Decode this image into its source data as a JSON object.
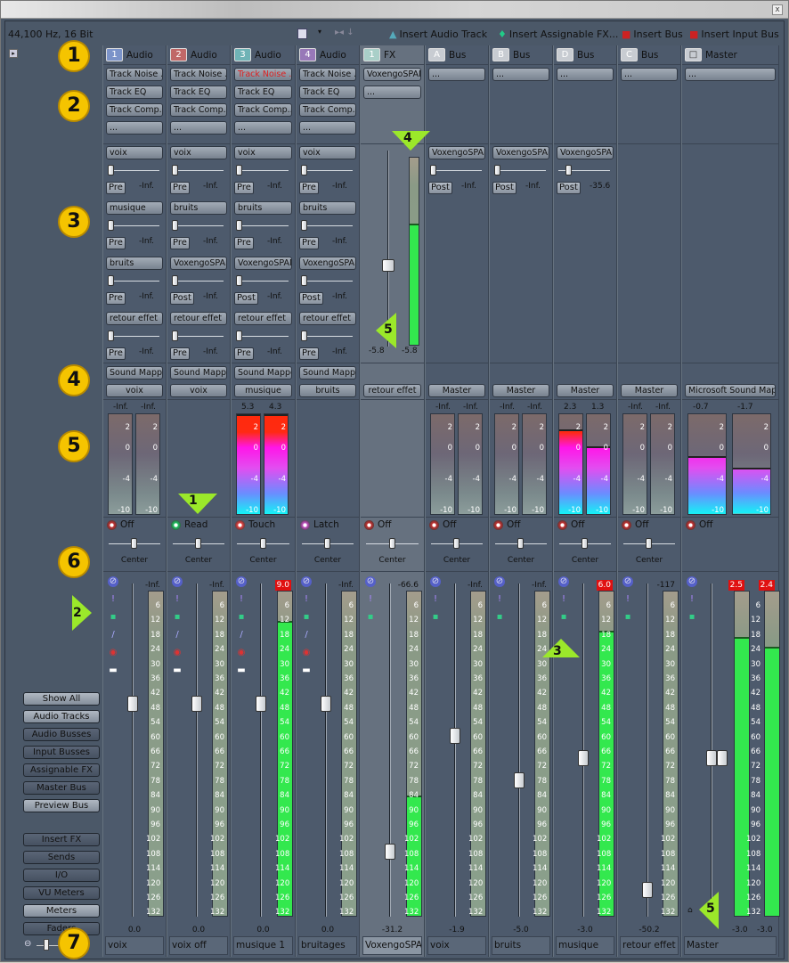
{
  "window": {
    "close_label": "x"
  },
  "toolbar": {
    "format": "44,100 Hz, 16 Bit",
    "insert_audio_track": "Insert Audio Track",
    "insert_assignable_fx": "Insert Assignable FX...",
    "insert_bus": "Insert Bus",
    "insert_input_bus": "Insert Input Bus"
  },
  "sidebar": {
    "view_buttons": [
      {
        "label": "Show All",
        "on": true
      },
      {
        "label": "Audio Tracks",
        "on": true
      },
      {
        "label": "Audio Busses",
        "on": false
      },
      {
        "label": "Input Busses",
        "on": false
      },
      {
        "label": "Assignable FX",
        "on": false
      },
      {
        "label": "Master Bus",
        "on": false
      },
      {
        "label": "Preview Bus",
        "on": true
      }
    ],
    "section_buttons": [
      {
        "label": "Insert FX",
        "on": false
      },
      {
        "label": "Sends",
        "on": false
      },
      {
        "label": "I/O",
        "on": false
      },
      {
        "label": "VU Meters",
        "on": false
      },
      {
        "label": "Meters",
        "on": true
      },
      {
        "label": "Faders",
        "on": false
      }
    ]
  },
  "callouts": {
    "c1": "1",
    "c2": "2",
    "c3": "3",
    "c4": "4",
    "c5": "5",
    "c6": "6",
    "c7": "7",
    "t1": "1",
    "t2": "2",
    "t3": "3",
    "t4": "4",
    "t5a": "5",
    "t5b": "5"
  },
  "fader_scale": [
    "6",
    "12",
    "18",
    "24",
    "30",
    "36",
    "42",
    "48",
    "54",
    "60",
    "66",
    "72",
    "78",
    "84",
    "90",
    "96",
    "102",
    "108",
    "114",
    "120",
    "126",
    "132"
  ],
  "meter_scale": [
    "2",
    "0",
    "-4",
    "-10"
  ],
  "channels": [
    {
      "num": "1",
      "type": "Audio",
      "color": "#7b93c9",
      "inserts": [
        "Track Noise ...",
        "Track EQ",
        "Track Comp...",
        "..."
      ],
      "sends": [
        {
          "dest": "voix",
          "mode": "Pre",
          "value": "-Inf."
        },
        {
          "dest": "musique",
          "mode": "Pre",
          "value": "-Inf."
        },
        {
          "dest": "bruits",
          "mode": "Pre",
          "value": "-Inf."
        },
        {
          "dest": "retour effet",
          "mode": "Pre",
          "value": "-Inf."
        }
      ],
      "input": "Sound Mapper",
      "output": "voix",
      "meter_values": [
        "-Inf.",
        "-Inf."
      ],
      "meter_levels": [
        0,
        0
      ],
      "automation": "Off",
      "pan": "Center",
      "peak": "-Inf.",
      "peak_over": false,
      "fader_levels": [
        0
      ],
      "fader_pos": 0.35,
      "gain": "0.0",
      "name": "voix"
    },
    {
      "num": "2",
      "type": "Audio",
      "color": "#c06868",
      "inserts": [
        "Track Noise ...",
        "Track EQ",
        "Track Comp...",
        "..."
      ],
      "sends": [
        {
          "dest": "voix",
          "mode": "Pre",
          "value": "-Inf."
        },
        {
          "dest": "bruits",
          "mode": "Pre",
          "value": "-Inf."
        },
        {
          "dest": "VoxengoSPAN",
          "mode": "Post",
          "value": "-Inf."
        },
        {
          "dest": "retour effet",
          "mode": "Pre",
          "value": "-Inf."
        }
      ],
      "input": "Sound Mapper",
      "output": "voix",
      "meter_values": [],
      "meter_levels": [],
      "automation": "Read",
      "pan": "Center",
      "peak": "-Inf.",
      "peak_over": false,
      "fader_levels": [
        0
      ],
      "fader_pos": 0.35,
      "gain": "0.0",
      "name": "voix off"
    },
    {
      "num": "3",
      "type": "Audio",
      "color": "#6fb3b6",
      "inserts": [
        "Track Noise ...",
        "Track EQ",
        "Track Comp...",
        "..."
      ],
      "insert_alert": 0,
      "sends": [
        {
          "dest": "voix",
          "mode": "Pre",
          "value": "-Inf."
        },
        {
          "dest": "bruits",
          "mode": "Pre",
          "value": "-Inf."
        },
        {
          "dest": "VoxengoSPAN",
          "mode": "Post",
          "value": "-Inf."
        },
        {
          "dest": "retour effet",
          "mode": "Pre",
          "value": "-Inf."
        }
      ],
      "input": "Sound Mapper",
      "output": "musique",
      "meter_values": [
        "5.3",
        "4.3"
      ],
      "meter_levels": [
        1,
        1
      ],
      "automation": "Touch",
      "pan": "Center",
      "peak": "9.0",
      "peak_over": true,
      "fader_levels": [
        0.91
      ],
      "fader_pos": 0.35,
      "gain": "0.0",
      "name": "musique 1"
    },
    {
      "num": "4",
      "type": "Audio",
      "color": "#9878b8",
      "inserts": [
        "Track Noise ...",
        "Track EQ",
        "Track Comp...",
        "..."
      ],
      "sends": [
        {
          "dest": "voix",
          "mode": "Pre",
          "value": "-Inf."
        },
        {
          "dest": "bruits",
          "mode": "Pre",
          "value": "-Inf."
        },
        {
          "dest": "VoxengoSPAN",
          "mode": "Post",
          "value": "-Inf."
        },
        {
          "dest": "retour effet",
          "mode": "Pre",
          "value": "-Inf."
        }
      ],
      "input": "Sound Mapper",
      "output": "bruits",
      "meter_values": [],
      "meter_levels": [],
      "automation": "Latch",
      "pan": "Center",
      "peak": "-Inf.",
      "peak_over": false,
      "fader_levels": [
        0
      ],
      "fader_pos": 0.35,
      "gain": "0.0",
      "name": "bruitages"
    },
    {
      "num": "1",
      "type": "FX",
      "color": "#a9cfc8",
      "fx": true,
      "inserts": [
        "VoxengoSPAN",
        "..."
      ],
      "sends": [],
      "fx_return": {
        "values": [
          "-5.8",
          "-5.8"
        ],
        "level": 0.65
      },
      "input": "",
      "output": "retour effet",
      "meter_values": [],
      "meter_levels": [],
      "automation": "Off",
      "pan": "Center",
      "peak": "-66.6",
      "peak_over": false,
      "fader_levels": [
        0.37
      ],
      "fader_pos": 0.81,
      "gain": "-31.2",
      "name": "VoxengoSPAN"
    },
    {
      "num": "A",
      "type": "Bus",
      "color": "#c8ccd2",
      "inserts": [
        "..."
      ],
      "sends": [
        {
          "dest": "VoxengoSPAN",
          "mode": "Post",
          "value": "-Inf."
        }
      ],
      "input": "",
      "output": "Master",
      "meter_values": [
        "-Inf.",
        "-Inf."
      ],
      "meter_levels": [
        0,
        0
      ],
      "automation": "Off",
      "pan": "Center",
      "peak": "-Inf.",
      "peak_over": false,
      "fader_levels": [
        0
      ],
      "fader_pos": 0.45,
      "gain": "-1.9",
      "name": "voix"
    },
    {
      "num": "B",
      "type": "Bus",
      "color": "#c8ccd2",
      "inserts": [
        "..."
      ],
      "sends": [
        {
          "dest": "VoxengoSPAN",
          "mode": "Post",
          "value": "-Inf."
        }
      ],
      "input": "",
      "output": "Master",
      "meter_values": [
        "-Inf.",
        "-Inf."
      ],
      "meter_levels": [
        0,
        0
      ],
      "automation": "Off",
      "pan": "Center",
      "peak": "-Inf.",
      "peak_over": false,
      "fader_levels": [
        0
      ],
      "fader_pos": 0.59,
      "gain": "-5.0",
      "name": "bruits"
    },
    {
      "num": "D",
      "type": "Bus",
      "color": "#c8ccd2",
      "inserts": [
        "..."
      ],
      "sends": [
        {
          "dest": "VoxengoSPAN",
          "mode": "Post",
          "value": "-35.6"
        }
      ],
      "input": "",
      "output": "Master",
      "meter_values": [
        "2.3",
        "1.3"
      ],
      "meter_levels": [
        0.85,
        0.68
      ],
      "automation": "Off",
      "pan": "Center",
      "peak": "6.0",
      "peak_over": true,
      "fader_levels": [
        0.88
      ],
      "fader_pos": 0.52,
      "gain": "-3.0",
      "name": "musique"
    },
    {
      "num": "C",
      "type": "Bus",
      "color": "#c8ccd2",
      "inserts": [
        "..."
      ],
      "sends": [],
      "input": "",
      "output": "Master",
      "meter_values": [
        "-Inf.",
        "-Inf."
      ],
      "meter_levels": [
        0,
        0
      ],
      "automation": "Off",
      "pan": "Center",
      "peak": "-117",
      "peak_over": false,
      "fader_levels": [
        0
      ],
      "fader_pos": 0.93,
      "gain": "-50.2",
      "name": "retour effet"
    },
    {
      "num": "□",
      "type": "Master",
      "color": "#c8ccd2",
      "master": true,
      "inserts": [
        "..."
      ],
      "sends": [],
      "input": "",
      "output": "Microsoft Sound Mapper",
      "meter_values": [
        "-0.7",
        "-1.7"
      ],
      "meter_levels": [
        0.58,
        0.46
      ],
      "automation": "Off",
      "pan": "",
      "peak": "2.5",
      "peak2": "2.4",
      "peak_over": true,
      "fader_levels": [
        0.86,
        0.83
      ],
      "fader_pos": 0.52,
      "gain": "-3.0",
      "gain2": "-3.0",
      "name": "Master"
    }
  ]
}
